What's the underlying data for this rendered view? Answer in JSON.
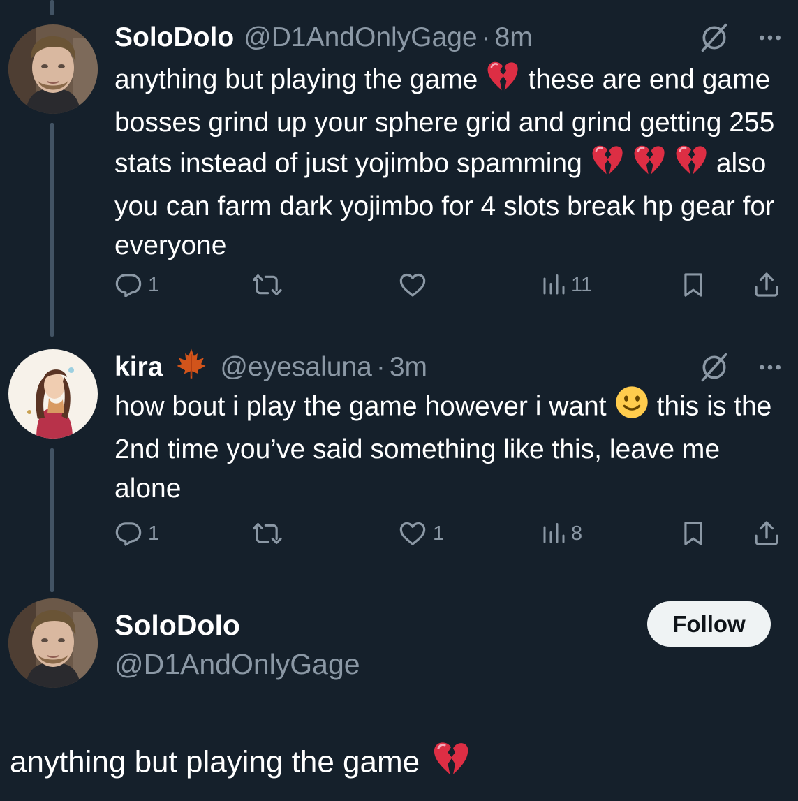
{
  "tweets": [
    {
      "display_name": "SoloDolo",
      "handle": "@D1AndOnlyGage",
      "separator": "·",
      "time": "8m",
      "text_parts": [
        "anything but playing the game",
        "these are end game bosses grind up your sphere grid and grind getting 255 stats instead of just yojimbo spamming",
        "also you can farm dark yojimbo for 4 slots break hp gear for everyone"
      ],
      "replies": "1",
      "reposts": "",
      "likes": "",
      "views": "11"
    },
    {
      "display_name": "kira",
      "name_emoji": "maple-leaf",
      "handle": "@eyesaluna",
      "separator": "·",
      "time": "3m",
      "text_parts": [
        "how bout i play the game however i want",
        "this is the 2nd time you’ve said something like this, leave me alone"
      ],
      "replies": "1",
      "reposts": "",
      "likes": "1",
      "views": "8"
    }
  ],
  "profile": {
    "display_name": "SoloDolo",
    "handle": "@D1AndOnlyGage",
    "follow_label": "Follow"
  },
  "quoted": {
    "text": "anything but playing the game"
  },
  "icons": {
    "reply": "reply-icon",
    "repost": "repost-icon",
    "like": "heart-icon",
    "views": "views-icon",
    "bookmark": "bookmark-icon",
    "share": "share-icon",
    "grok": "grok-icon",
    "more": "more-icon",
    "broken_heart": "broken-heart-emoji",
    "smile": "smile-emoji"
  },
  "colors": {
    "background": "#15202b",
    "text": "#ffffff",
    "secondary_text": "#8b98a5",
    "thread_line": "#425364",
    "broken_heart": "#dd2e44",
    "follow_bg": "#eff3f4"
  }
}
